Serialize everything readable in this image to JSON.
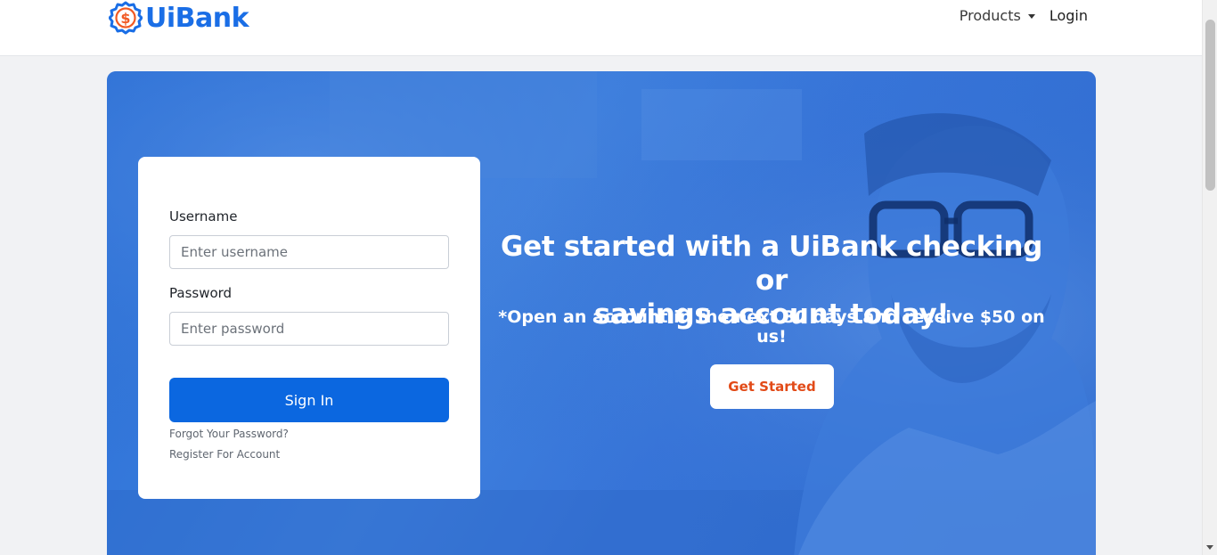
{
  "brand": {
    "name": "UiBank",
    "badge_symbol": "$",
    "primary_color": "#1a6ee6",
    "accent_color": "#f15a24"
  },
  "nav": {
    "products_label": "Products",
    "login_label": "Login"
  },
  "login_form": {
    "username_label": "Username",
    "username_placeholder": "Enter username",
    "password_label": "Password",
    "password_placeholder": "Enter password",
    "signin_label": "Sign In",
    "forgot_label": "Forgot Your Password?",
    "register_label": "Register For Account"
  },
  "hero": {
    "headline_line1": "Get started with a UiBank checking or",
    "headline_line2": "savings account today!",
    "subline": "*Open an account in the next 30 days and receive $50 on us!",
    "cta_label": "Get Started",
    "cta_color": "#e24a17"
  }
}
